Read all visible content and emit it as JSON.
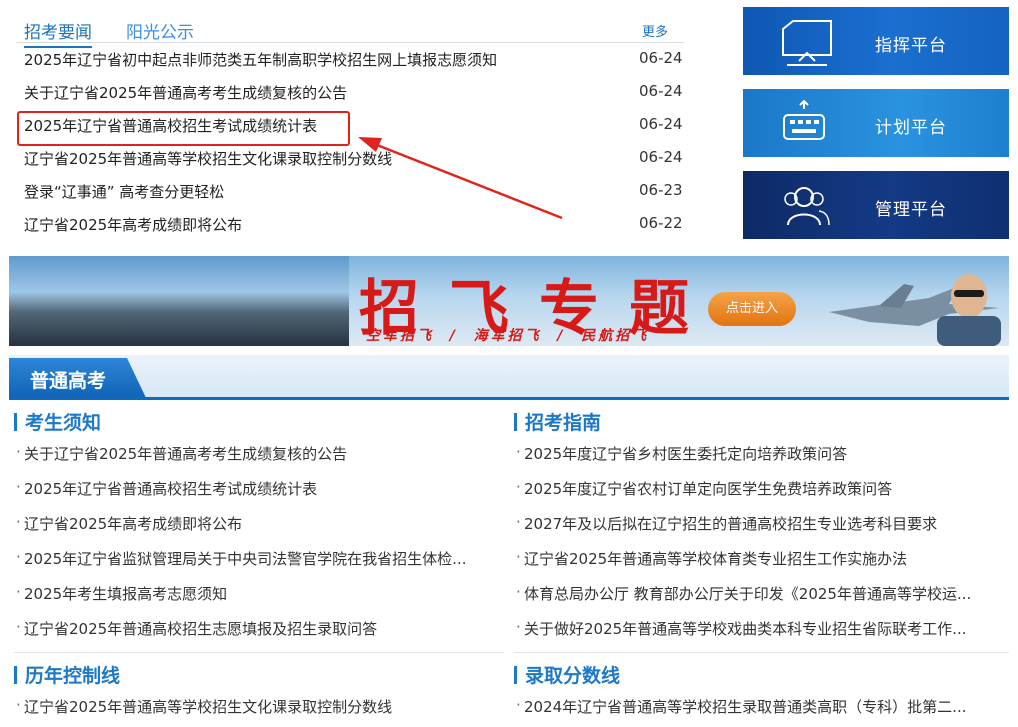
{
  "news": {
    "tabs": [
      "招考要闻",
      "阳光公示"
    ],
    "more": "更多",
    "items": [
      {
        "title": "2025年辽宁省初中起点非师范类五年制高职学校招生网上填报志愿须知",
        "date": "06-24"
      },
      {
        "title": "关于辽宁省2025年普通高考考生成绩复核的公告",
        "date": "06-24"
      },
      {
        "title": "2025年辽宁省普通高校招生考试成绩统计表",
        "date": "06-24"
      },
      {
        "title": "辽宁省2025年普通高等学校招生文化课录取控制分数线",
        "date": "06-24"
      },
      {
        "title": "登录“辽事通” 高考查分更轻松",
        "date": "06-23"
      },
      {
        "title": "辽宁省2025年高考成绩即将公布",
        "date": "06-22"
      }
    ]
  },
  "platforms": [
    {
      "label": "指挥平台",
      "icon": "monitor-icon"
    },
    {
      "label": "计划平台",
      "icon": "keyboard-icon"
    },
    {
      "label": "管理平台",
      "icon": "users-icon"
    }
  ],
  "banner": {
    "title": "招飞专题",
    "subtitle": "空军招飞  /  海军招飞  /  民航招飞",
    "enter": "点击进入"
  },
  "section": {
    "title": "普通高考",
    "columns": [
      {
        "heading": "考生须知",
        "items": [
          "关于辽宁省2025年普通高考考生成绩复核的公告",
          "2025年辽宁省普通高校招生考试成绩统计表",
          "辽宁省2025年高考成绩即将公布",
          "2025年辽宁省监狱管理局关于中央司法警官学院在我省招生体检...",
          "2025年考生填报高考志愿须知",
          "辽宁省2025年普通高校招生志愿填报及招生录取问答"
        ]
      },
      {
        "heading": "招考指南",
        "items": [
          "2025年度辽宁省乡村医生委托定向培养政策问答",
          "2025年度辽宁省农村订单定向医学生免费培养政策问答",
          "2027年及以后拟在辽宁招生的普通高校招生专业选考科目要求",
          "辽宁省2025年普通高等学校体育类专业招生工作实施办法",
          "体育总局办公厅 教育部办公厅关于印发《2025年普通高等学校运...",
          "关于做好2025年普通高等学校戏曲类本科专业招生省际联考工作..."
        ]
      },
      {
        "heading": "历年控制线",
        "items": [
          "辽宁省2025年普通高等学校招生文化课录取控制分数线"
        ]
      },
      {
        "heading": "录取分数线",
        "items": [
          "2024年辽宁省普通高等学校招生录取普通类高职（专科）批第二..."
        ]
      }
    ]
  },
  "colors": {
    "accent": "#1e73be",
    "highlight": "#e0241b",
    "banner_red": "#d71a17"
  }
}
